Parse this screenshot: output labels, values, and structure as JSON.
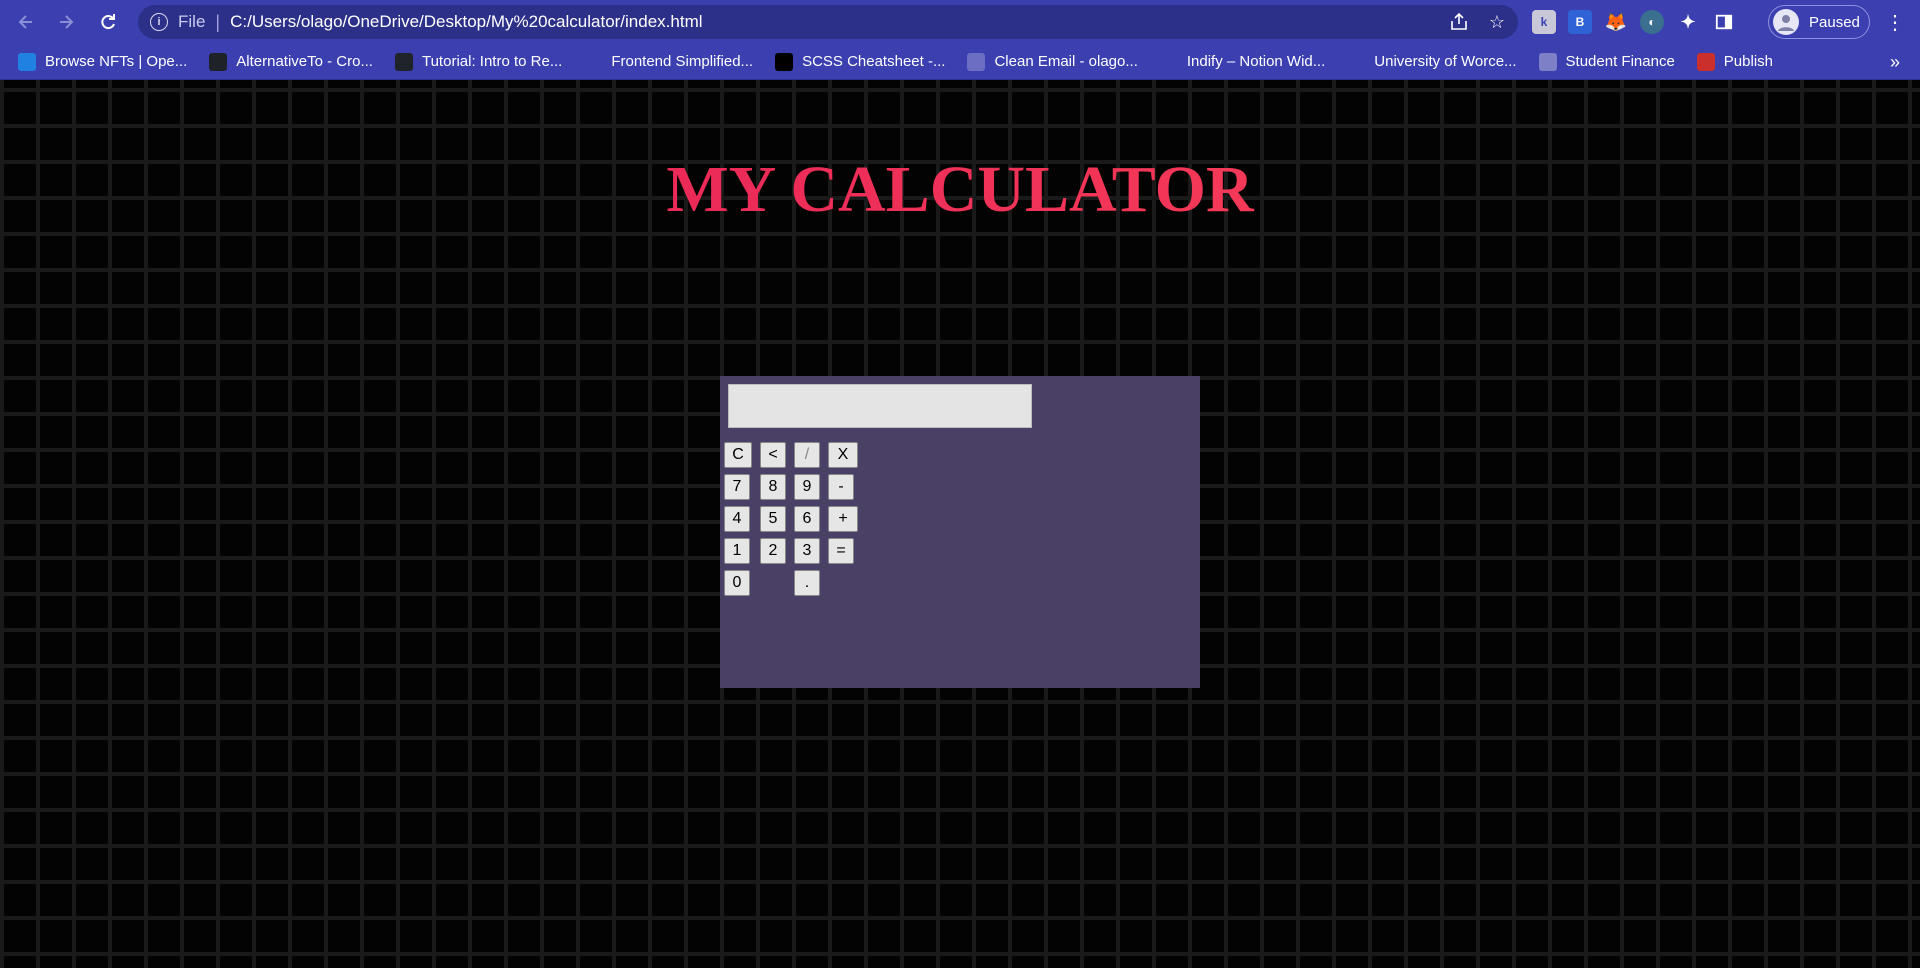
{
  "browser": {
    "omnibox": {
      "scheme": "File",
      "url": "C:/Users/olago/OneDrive/Desktop/My%20calculator/index.html"
    },
    "profile": {
      "label": "Paused"
    },
    "bookmarks": [
      {
        "label": "Browse NFTs | Ope...",
        "icon": "opensea-icon",
        "color": "#2081e2"
      },
      {
        "label": "AlternativeTo - Cro...",
        "icon": "alternativeto-icon",
        "color": "#1f2227"
      },
      {
        "label": "Tutorial: Intro to Re...",
        "icon": "react-icon",
        "color": "#20232a"
      },
      {
        "label": "Frontend Simplified...",
        "icon": "code-icon",
        "color": "#3b3fb0"
      },
      {
        "label": "SCSS Cheatsheet -...",
        "icon": "dev-icon",
        "color": "#000000"
      },
      {
        "label": "Clean Email - olago...",
        "icon": "cleanemail-icon",
        "color": "#6b6ec2"
      },
      {
        "label": "Indify – Notion Wid...",
        "icon": "feather-icon",
        "color": "#3b3fb0"
      },
      {
        "label": "University of Worce...",
        "icon": "university-icon",
        "color": "#3b3fb0"
      },
      {
        "label": "Student Finance",
        "icon": "globe-icon",
        "color": "#7d80c7"
      },
      {
        "label": "Publish",
        "icon": "publish-icon",
        "color": "#c9302c"
      }
    ]
  },
  "page": {
    "title": "MY CALCULATOR",
    "title_gradient": [
      "#e0185a",
      "#ff4a55"
    ],
    "calculator": {
      "display_value": "",
      "keys": {
        "clear": "C",
        "back": "<",
        "divide": "/",
        "multiply": "X",
        "seven": "7",
        "eight": "8",
        "nine": "9",
        "minus": "-",
        "four": "4",
        "five": "5",
        "six": "6",
        "plus": "+",
        "one": "1",
        "two": "2",
        "three": "3",
        "equals": "=",
        "zero": "0",
        "decimal": "."
      }
    }
  }
}
